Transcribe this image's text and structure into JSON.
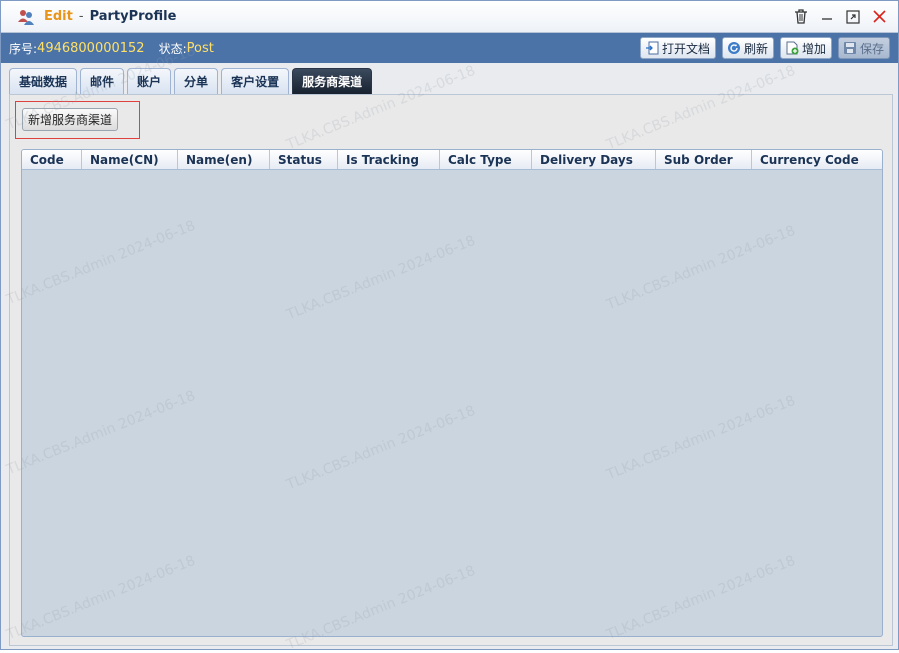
{
  "window": {
    "mode_label": "Edit",
    "separator": "-",
    "title": "PartyProfile"
  },
  "info": {
    "serial_label": "序号:",
    "serial_value": "4946800000152",
    "status_label": "状态:",
    "status_value": "Post"
  },
  "toolbar": {
    "open_doc": "打开文档",
    "refresh": "刷新",
    "add": "增加",
    "save": "保存"
  },
  "tabs": [
    {
      "label": "基础数据",
      "active": false
    },
    {
      "label": "邮件",
      "active": false
    },
    {
      "label": "账户",
      "active": false
    },
    {
      "label": "分单",
      "active": false
    },
    {
      "label": "客户设置",
      "active": false
    },
    {
      "label": "服务商渠道",
      "active": true
    }
  ],
  "panel": {
    "add_channel_button": "新增服务商渠道"
  },
  "grid": {
    "columns": [
      "Code",
      "Name(CN)",
      "Name(en)",
      "Status",
      "Is Tracking",
      "Calc Type",
      "Delivery Days",
      "Sub Order",
      "Currency Code"
    ],
    "rows": []
  },
  "watermark": "TLKA.CBS.Admin 2024-06-18",
  "colors": {
    "infobar": "#4b73a8",
    "accent_yellow": "#ffe066",
    "edit_orange": "#e8961b",
    "close_red": "#d9241c",
    "grid_body": "#cbd5df"
  }
}
